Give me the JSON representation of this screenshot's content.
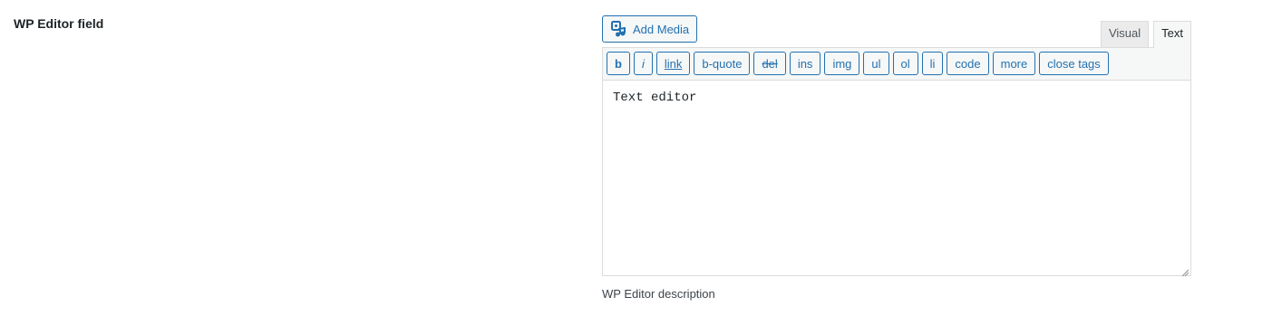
{
  "field": {
    "label": "WP Editor field",
    "description": "WP Editor description"
  },
  "toolbar": {
    "add_media_label": "Add Media",
    "add_media_icon": "media-icon",
    "tabs": [
      {
        "label": "Visual",
        "active": false
      },
      {
        "label": "Text",
        "active": true
      }
    ],
    "quicktags": [
      "b",
      "i",
      "link",
      "b-quote",
      "del",
      "ins",
      "img",
      "ul",
      "ol",
      "li",
      "code",
      "more",
      "close tags"
    ]
  },
  "editor": {
    "content": "Text editor"
  },
  "colors": {
    "accent": "#2271b1",
    "border": "#dcdcde",
    "toolbar_bg": "#f6f7f7"
  }
}
